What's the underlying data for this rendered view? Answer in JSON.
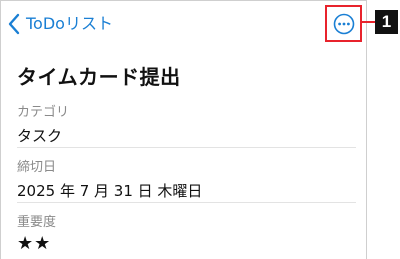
{
  "colors": {
    "accent": "#1a7fd4",
    "highlight": "#e8232c",
    "label": "#8a8a8a",
    "text": "#111111",
    "badge_bg": "#111111"
  },
  "navbar": {
    "back_icon": "chevron-left-icon",
    "back_label": "ToDoリスト",
    "more_icon": "ellipsis-circle-icon"
  },
  "task": {
    "title": "タイムカード提出",
    "fields": [
      {
        "label": "カテゴリ",
        "value": "タスク"
      },
      {
        "label": "締切日",
        "value": "2025 年 7 月 31 日 木曜日"
      },
      {
        "label": "重要度",
        "value": "★★"
      }
    ]
  },
  "importance": {
    "stars_filled": 2
  },
  "callout": {
    "number": "1"
  }
}
